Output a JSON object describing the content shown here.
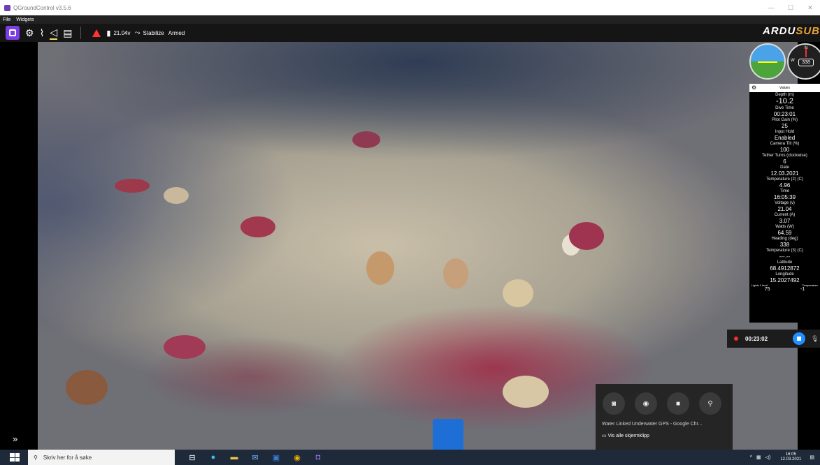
{
  "window": {
    "title": "QGroundControl v3.5.6",
    "minimize": "—",
    "maximize": "☐",
    "close": "✕"
  },
  "menu": {
    "file": "File",
    "widgets": "Widgets"
  },
  "toolbar": {
    "battery": "21.04v",
    "mode": "Stabilize",
    "armed": "Armed",
    "brand_a": "ARDU",
    "brand_b": "SUB"
  },
  "compass": {
    "heading": "338",
    "north": "N",
    "west": "W"
  },
  "values_panel": {
    "header": "Values",
    "items": [
      {
        "label": "Depth (m)",
        "value": "-10.2"
      },
      {
        "label": "Dive Time",
        "value": "00:23:01"
      },
      {
        "label": "Pilot Gain (%)",
        "value": "25"
      },
      {
        "label": "Input Hold",
        "value": "Enabled"
      },
      {
        "label": "Camera Tilt (%)",
        "value": "100"
      },
      {
        "label": "Tether Turns (clockwise)",
        "value": "6"
      },
      {
        "label": "Date",
        "value": "12.03.2021"
      },
      {
        "label": "Temperature (2) (C)",
        "value": "4.96"
      },
      {
        "label": "Time",
        "value": "16:05:39"
      },
      {
        "label": "Voltage (v)",
        "value": "21.04"
      },
      {
        "label": "Current (A)",
        "value": "3.07"
      },
      {
        "label": "Watts (W)",
        "value": "64.59"
      },
      {
        "label": "Heading (deg)",
        "value": "338"
      },
      {
        "label": "Temperature (3) (C)",
        "value": "---.--"
      },
      {
        "label": "Latitude",
        "value": "68.4912872"
      },
      {
        "label": "Longitude",
        "value": "15.2027492"
      }
    ],
    "bottom": {
      "lights_label": "Lights 1 level",
      "lights_value": "75",
      "temp_label": "Temperature",
      "temp_value": "-1"
    }
  },
  "recording": {
    "time": "00:23:02"
  },
  "gamebar": {
    "title": "Water Linked Underwater GPS - Google Chr...",
    "link": "Vis alle skjermklipp"
  },
  "taskbar": {
    "search_placeholder": "Skriv her for å søke",
    "time": "16:05",
    "date": "12.03.2021"
  }
}
